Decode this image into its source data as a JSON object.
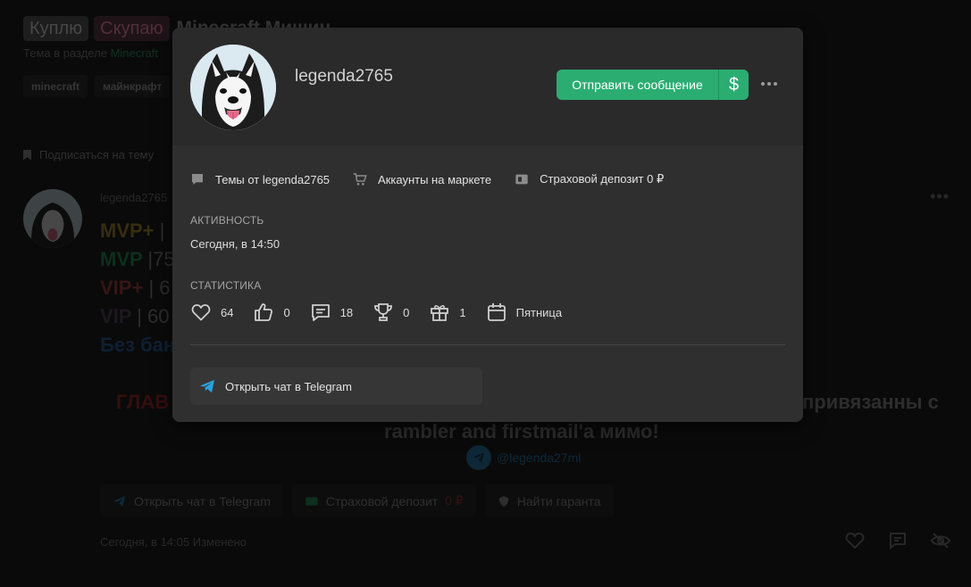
{
  "background": {
    "prefixes": [
      "Куплю",
      "Скупаю"
    ],
    "thread_title": "Minecraft Мишин...",
    "section_text": "Тема в разделе",
    "section_link": "Minecraft",
    "tags": [
      "minecraft",
      "майнкрафт"
    ],
    "subscribe_label": "Подписаться на тему",
    "post_author": "legenda2765",
    "ranks": [
      {
        "name": "MVP+",
        "rest": "|"
      },
      {
        "name": "MVP",
        "rest": "|75"
      },
      {
        "name": "VIP+",
        "rest": "| 6"
      },
      {
        "name": "VIP",
        "rest": "| 60"
      },
      {
        "name": "Без бан",
        "rest": ""
      }
    ],
    "warning_left": "ГЛАВ",
    "warning_right": "привязанны с",
    "center_line": "rambler and firstmail'a мимо!",
    "telegram_handle": "@legenda27ml",
    "post_buttons": {
      "telegram": "Открыть чат в Telegram",
      "deposit": "Страховой депозит",
      "deposit_value": "0 ₽",
      "guarantor": "Найти гаранта"
    },
    "post_date": "Сегодня, в 14:05",
    "edited_label": "Изменено"
  },
  "card": {
    "username": "legenda2765",
    "send_message_label": "Отправить сообщение",
    "money_button_symbol": "$",
    "links": {
      "threads": "Темы от legenda2765",
      "market": "Аккаунты на маркете",
      "deposit": "Страховой депозит 0 ₽"
    },
    "activity_label": "АКТИВНОСТЬ",
    "activity_value": "Сегодня, в 14:50",
    "stats_label": "СТАТИСТИКА",
    "stats": {
      "likes": "64",
      "thumbs": "0",
      "messages": "18",
      "trophies": "0",
      "gifts": "1",
      "birthday": "Пятница"
    },
    "telegram_button_label": "Открыть чат в Telegram"
  },
  "colors": {
    "accent_green": "#2bad72",
    "telegram_blue": "#2aa3e0",
    "card_bg": "#2f2f2f"
  }
}
